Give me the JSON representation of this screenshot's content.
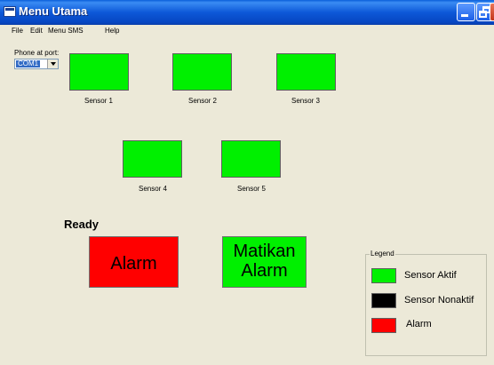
{
  "window": {
    "title": "Menu Utama"
  },
  "menu": [
    "File",
    "Edit",
    "Menu SMS",
    "Help"
  ],
  "port": {
    "label": "Phone at port:",
    "value": "COM1"
  },
  "sensors": [
    "Sensor 1",
    "Sensor 2",
    "Sensor 3",
    "Sensor 4",
    "Sensor 5"
  ],
  "status": "Ready",
  "buttons": {
    "alarm": "Alarm",
    "stop_line1": "Matikan",
    "stop_line2": "Alarm"
  },
  "legend": {
    "title": "Legend",
    "items": [
      {
        "label": "Sensor Aktif",
        "color": "#00f000"
      },
      {
        "label": "Sensor Nonaktif",
        "color": "#000000"
      },
      {
        "label": "Alarm",
        "color": "#ff0000"
      }
    ]
  },
  "colors": {
    "titlebar": "#0a5fd9",
    "window_bg": "#ece9d8",
    "sensor_active": "#00f000",
    "alarm": "#ff0000"
  }
}
